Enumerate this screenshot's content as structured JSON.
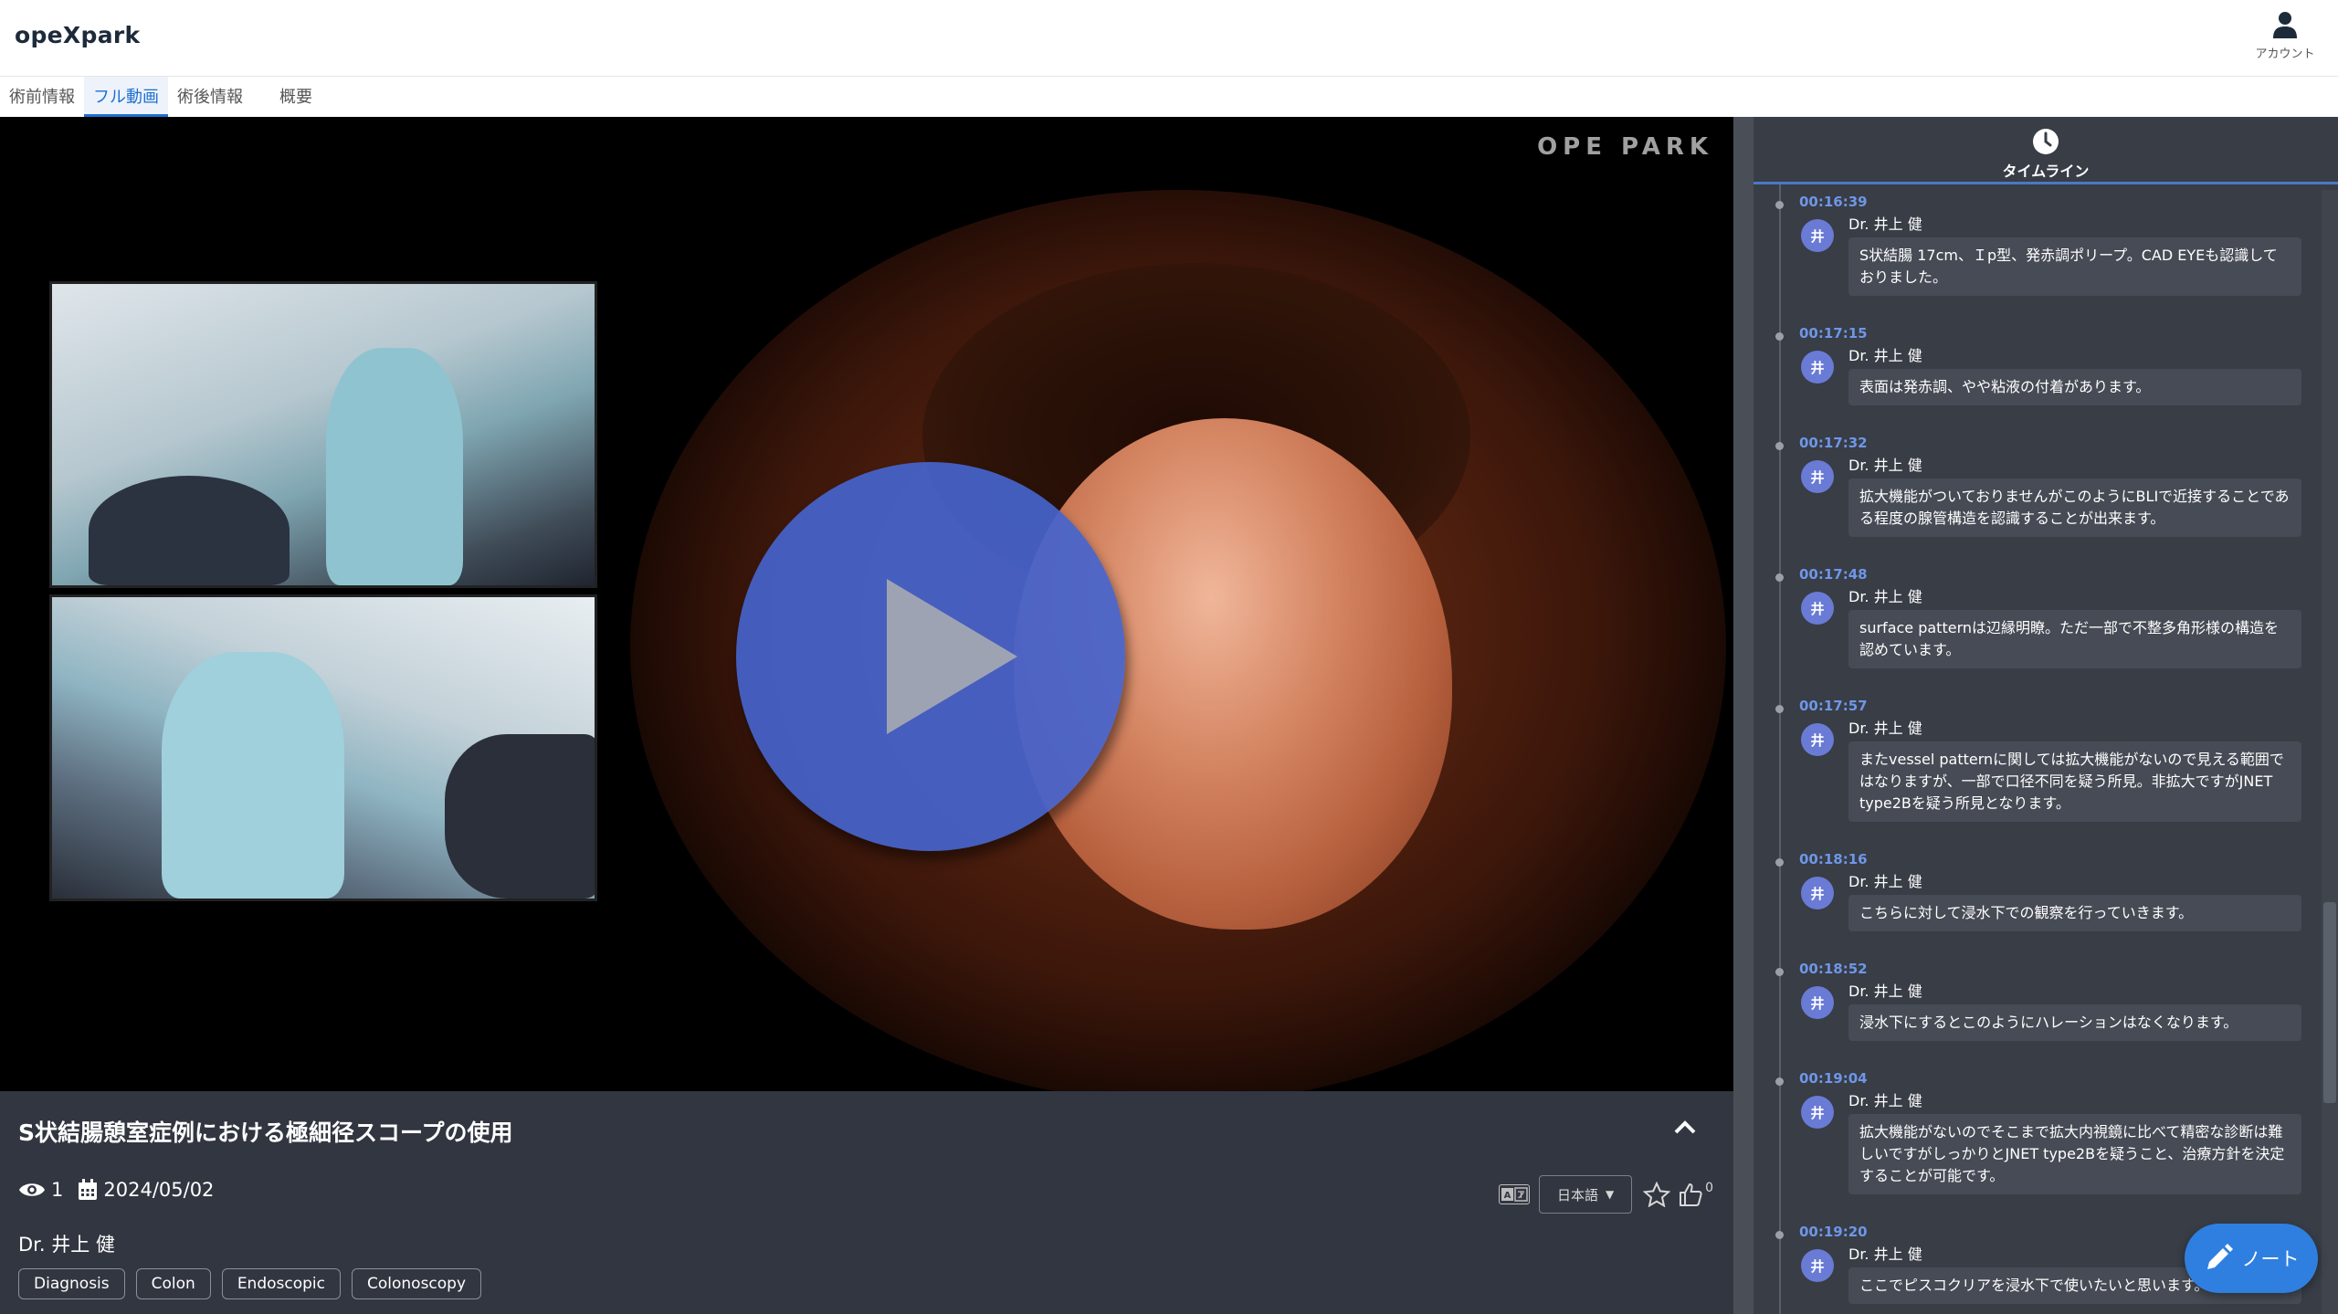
{
  "app": {
    "logo": "opeXpark",
    "account_label": "アカウント"
  },
  "tabs": [
    {
      "label": "術前情報",
      "active": false
    },
    {
      "label": "フル動画",
      "active": true
    },
    {
      "label": "術後情報",
      "active": false
    },
    {
      "label": "概要",
      "active": false
    }
  ],
  "video": {
    "watermark": "OPE PARK"
  },
  "info": {
    "title": "S状結腸憩室症例における極細径スコープの使用",
    "views": "1",
    "date": "2024/05/02",
    "author": "Dr. 井上 健",
    "tags": [
      "Diagnosis",
      "Colon",
      "Endoscopic",
      "Colonoscopy"
    ],
    "language": "日本語",
    "likes": "0"
  },
  "timeline": {
    "title": "タイムライン",
    "entries": [
      {
        "time": "00:16:39",
        "avatar": "井",
        "author": "Dr. 井上 健",
        "text": "S状結腸 17cm、Ｉp型、発赤調ポリープ。CAD EYEも認識しておりました。"
      },
      {
        "time": "00:17:15",
        "avatar": "井",
        "author": "Dr. 井上 健",
        "text": "表面は発赤調、やや粘液の付着があります。"
      },
      {
        "time": "00:17:32",
        "avatar": "井",
        "author": "Dr. 井上 健",
        "text": "拡大機能がついておりませんがこのようにBLIで近接することである程度の腺管構造を認識することが出来ます。"
      },
      {
        "time": "00:17:48",
        "avatar": "井",
        "author": "Dr. 井上 健",
        "text": "surface patternは辺縁明瞭。ただ一部で不整多角形様の構造を認めています。"
      },
      {
        "time": "00:17:57",
        "avatar": "井",
        "author": "Dr. 井上 健",
        "text": "またvessel patternに関しては拡大機能がないので見える範囲ではなりますが、一部で口径不同を疑う所見。非拡大ですがJNET type2Bを疑う所見となります。"
      },
      {
        "time": "00:18:16",
        "avatar": "井",
        "author": "Dr. 井上 健",
        "text": "こちらに対して浸水下での観察を行っていきます。"
      },
      {
        "time": "00:18:52",
        "avatar": "井",
        "author": "Dr. 井上 健",
        "text": "浸水下にするとこのようにハレーションはなくなります。"
      },
      {
        "time": "00:19:04",
        "avatar": "井",
        "author": "Dr. 井上 健",
        "text": "拡大機能がないのでそこまで拡大内視鏡に比べて精密な診断は難しいですがしっかりとJNET type2Bを疑うこと、治療方針を決定することが可能です。"
      },
      {
        "time": "00:19:20",
        "avatar": "井",
        "author": "Dr. 井上 健",
        "text": "ここでピスコクリアを浸水下で使いたいと思います。"
      }
    ]
  },
  "note_button": {
    "label": "ノート"
  },
  "colors": {
    "accent": "#1e6fd0",
    "play_button": "#4564cd",
    "panel_bg": "#313640",
    "timeline_bg": "#383d46",
    "timestamp": "#6f96e8",
    "avatar": "#6a7bd6",
    "note_button": "#2f7fe0"
  },
  "icons": {
    "account": "user-icon",
    "timeline": "clock-icon",
    "views": "eye-icon",
    "date": "calendar-icon",
    "collapse": "chevron-up-icon",
    "translate": "translate-icon",
    "favorite": "star-icon",
    "like": "thumbs-up-icon",
    "note": "pencil-icon",
    "play": "play-icon"
  }
}
